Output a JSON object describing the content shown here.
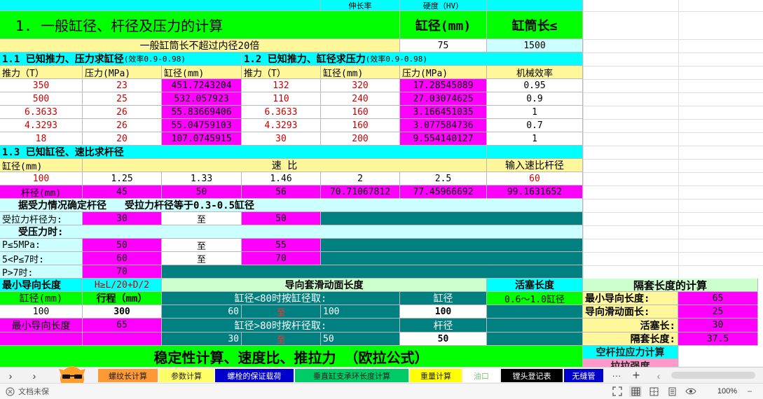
{
  "colors": {
    "yellow_header": "#fff799",
    "green": "#00ff00",
    "cyan": "#00ffff",
    "magenta": "#ff00ff",
    "teal": "#008080",
    "light_cyan": "#ccffff",
    "light_green": "#ccffcc",
    "pink": "#ff99cc",
    "red_text": "#cc0000"
  },
  "top_strip": {
    "c1": "伸长率",
    "c2": "硬度（HV）"
  },
  "sec1": {
    "title": "1.   一般缸径、杆径及压力的计算",
    "bore_hdr": "缸径(mm)",
    "barrel_hdr": "缸筒长≤",
    "note": "一般缸筒长不超过内径20倍",
    "bore_val": "75",
    "barrel_val": "1500"
  },
  "sec11": {
    "title": "1.1 已知推力、压力求缸径",
    "eff": "(效率0.9-0.98)",
    "headers": [
      "推力（T）",
      "压力(MPa)",
      "缸径(mm)"
    ],
    "rows": [
      [
        "350",
        "23",
        "451.7243204"
      ],
      [
        "500",
        "25",
        "532.057923"
      ],
      [
        "6.3633",
        "26",
        "55.83669406"
      ],
      [
        "4.3293",
        "26",
        "55.04759103"
      ],
      [
        "18",
        "20",
        "107.0745915"
      ]
    ]
  },
  "sec12": {
    "title": "1.2 已知推力、缸径求压力",
    "eff": "(效率0.9-0.98)",
    "headers": [
      "推力（T）",
      "缸径(mm)",
      "压力(MPa)",
      "机械效率"
    ],
    "rows": [
      [
        "132",
        "320",
        "17.28545089",
        "0.95"
      ],
      [
        "110",
        "240",
        "27.03074625",
        "0.9"
      ],
      [
        "6.3633",
        "160",
        "3.166451035",
        "1"
      ],
      [
        "4.3293",
        "160",
        "3.077584736",
        "0.7"
      ],
      [
        "30",
        "200",
        "9.554140127",
        "1"
      ]
    ]
  },
  "sec13": {
    "title": "1.3 已知缸径、速比求杆径",
    "bore_hdr": "缸径(mm)",
    "ratio_hdr": "速  比",
    "input_hdr": "输入速比杆径",
    "bore_val": "100",
    "ratios": [
      "1.25",
      "1.33",
      "1.46",
      "2",
      "2.5"
    ],
    "input_val": "60",
    "rod_label": "杆径(mm)",
    "rods": [
      "45",
      "50",
      "56",
      "70.71067812",
      "77.45966692",
      "99.1631652"
    ]
  },
  "force": {
    "title": "据受力情况确定杆径",
    "note": "受拉力杆径等于0.3-0.5缸径",
    "tension_label": "受拉力杆径为:",
    "tension_lo": "30",
    "to": "至",
    "tension_hi": "50",
    "compress_title": "受压力时:",
    "p1_label": "P≤5MPa:",
    "p1_lo": "50",
    "p1_hi": "55",
    "p2_label": "5<P≤7时:",
    "p2_lo": "60",
    "p2_hi": "70",
    "p3_label": "P>7时:",
    "p3_val": "70"
  },
  "guide": {
    "min_len_title": "最小导向长度",
    "formula": "H≥L/20+D/2",
    "sleeve_title": "导向套滑动面长度",
    "piston_title": "活塞长度",
    "bore_hdr": "缸径(mm)",
    "stroke_hdr": "行程（mm）",
    "lt80": "缸径<80时按缸径取:",
    "gt80": "缸径>80时按杆径取:",
    "bore_lbl": "缸径",
    "rod_lbl": "杆径",
    "piston_rule": "0.6～1.0缸径",
    "bore_val": "100",
    "stroke_val": "300",
    "min_len_lbl": "最小导向长度",
    "min_len_val": "65",
    "lt_lo": "60",
    "lt_to": "至",
    "lt_hi": "100",
    "bore_res": "100",
    "gt_lo": "30",
    "gt_to": "至",
    "gt_hi": "50",
    "rod_res": "50"
  },
  "spacer": {
    "title": "隔套长度的计算",
    "r1": "最小导向长度:",
    "v1": "65",
    "r2": "导向滑动面长:",
    "v2": "25",
    "r3": "活塞长:",
    "v3": "30",
    "r4": "隔套长度:",
    "v4": "37.5"
  },
  "bottom": {
    "title": "稳定性计算、速度比、推拉力 （欧拉公式）",
    "rod_stress": "空杆拉应力计算",
    "tensile": "拉拉强度"
  },
  "tabs": [
    "螺纹长计算",
    "参数计算",
    "螺栓的保证载荷",
    "垂直缸支承环长度计算",
    "重量计算",
    "油口",
    "镗头登记表",
    "无缝管"
  ],
  "status": {
    "doc_state": "文档未保",
    "zoom": "100%",
    "more": "···",
    "plus": "+"
  }
}
